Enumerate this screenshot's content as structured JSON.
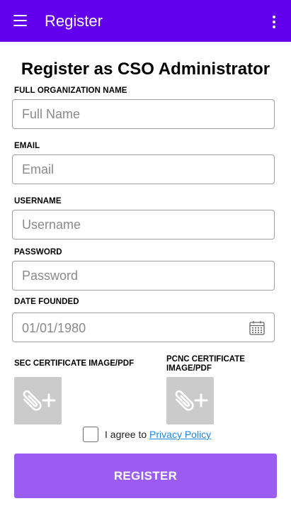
{
  "app_bar": {
    "title": "Register",
    "background": "#6200ee",
    "menu_icon": "hamburger-menu-icon",
    "overflow_icon": "more-vert-icon"
  },
  "page": {
    "heading": "Register as CSO Administrator"
  },
  "form": {
    "organization": {
      "label": "FULL ORGANIZATION NAME",
      "placeholder": "Full Name",
      "value": ""
    },
    "email": {
      "label": "EMAIL",
      "placeholder": "Email",
      "value": ""
    },
    "username": {
      "label": "USERNAME",
      "placeholder": "Username",
      "value": ""
    },
    "password": {
      "label": "PASSWORD",
      "placeholder": "Password",
      "value": ""
    },
    "date_founded": {
      "label": "DATE FOUNDED",
      "value": "01/01/1980",
      "icon": "calendar-icon"
    }
  },
  "uploads": {
    "sec": {
      "label": "SEC CERTIFICATE IMAGE/PDF",
      "icon": "attach-file-add-icon"
    },
    "pcnc": {
      "label": "PCNC CERTIFICATE IMAGE/PDF",
      "icon": "attach-file-add-icon"
    }
  },
  "agreement": {
    "checked": false,
    "text": "I agree to ",
    "link_text": "Privacy Policy",
    "link_color": "#1e88e5"
  },
  "register_button": {
    "label": "REGISTER",
    "color": "#9b5cf3"
  }
}
